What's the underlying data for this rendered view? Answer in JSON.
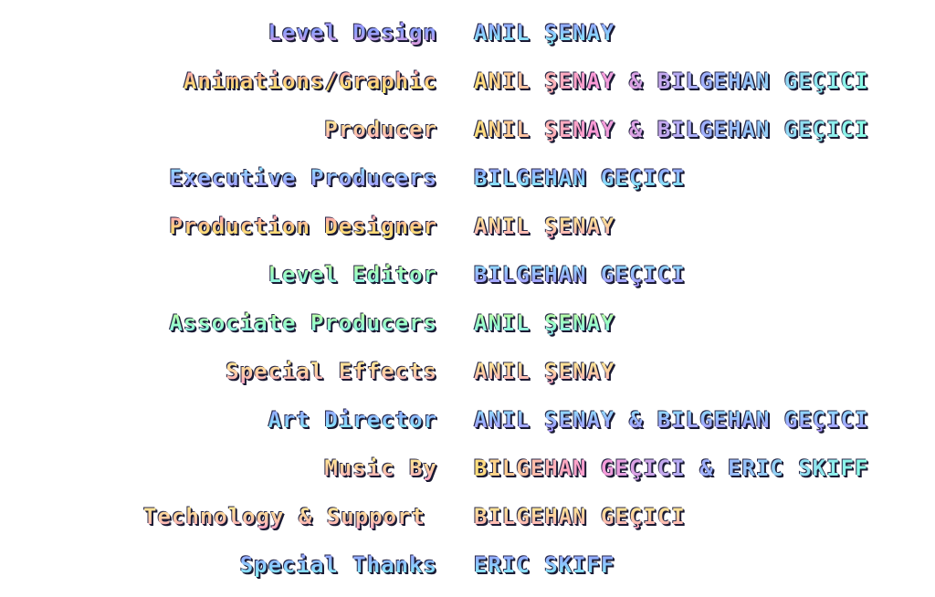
{
  "credits": [
    {
      "role": "Level Design",
      "name": "ANIL ŞENAY"
    },
    {
      "role": "Animations/Graphic",
      "name": "ANIL ŞENAY & BILGEHAN GEÇICI"
    },
    {
      "role": "Producer",
      "name": "ANIL ŞENAY & BILGEHAN GEÇICI"
    },
    {
      "role": "Executive Producers",
      "name": "BILGEHAN GEÇICI"
    },
    {
      "role": "Production Designer",
      "name": "ANIL ŞENAY"
    },
    {
      "role": "Level Editor",
      "name": "BILGEHAN GEÇICI"
    },
    {
      "role": "Associate Producers",
      "name": "ANIL ŞENAY"
    },
    {
      "role": "Special Effects",
      "name": "ANIL ŞENAY"
    },
    {
      "role": "Art Director",
      "name": "ANIL ŞENAY & BILGEHAN GEÇICI"
    },
    {
      "role": "Music By",
      "name": "BILGEHAN GEÇICI & ERIC SKIFF"
    },
    {
      "role": "Technology & Support",
      "name": "BILGEHAN GEÇICI"
    },
    {
      "role": "Special Thanks",
      "name": "ERIC SKIFF"
    }
  ],
  "colors": {
    "background": "#ffffff",
    "text_shadow": "#1a1a33"
  }
}
